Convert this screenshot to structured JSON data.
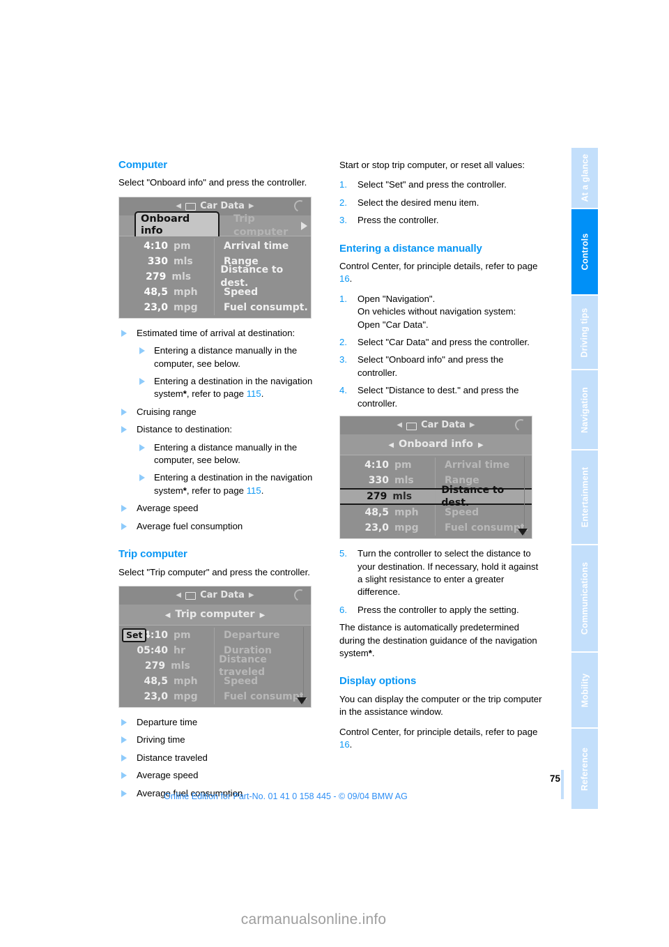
{
  "document": {
    "page_number": "75",
    "edition_line": "Online Edition for Part-No. 01 41 0 158 445 - © 09/04 BMW AG",
    "watermark": "carmanualsonline.info"
  },
  "colors": {
    "accent_blue": "#0a97f5",
    "tab_active": "#0090f7",
    "tab_inactive": "#c3dffb",
    "bullet_marker": "#8ecbfb"
  },
  "tabs": [
    {
      "label": "At a glance",
      "active": false
    },
    {
      "label": "Controls",
      "active": true
    },
    {
      "label": "Driving tips",
      "active": false
    },
    {
      "label": "Navigation",
      "active": false
    },
    {
      "label": "Entertainment",
      "active": false
    },
    {
      "label": "Communications",
      "active": false
    },
    {
      "label": "Mobility",
      "active": false
    },
    {
      "label": "Reference",
      "active": false
    }
  ],
  "left_column": {
    "computer": {
      "heading": "Computer",
      "intro": "Select \"Onboard info\" and press the controller.",
      "bullets": [
        {
          "text": "Estimated time of arrival at destination:",
          "sub": [
            {
              "text": "Entering a distance manually in the computer, see below."
            },
            {
              "text_pre": "Entering a destination in the navigation system",
              "star": "*",
              "text_mid": ", refer to page ",
              "page": "115",
              "text_post": "."
            }
          ]
        },
        {
          "text": "Cruising range",
          "sub": []
        },
        {
          "text": "Distance to destination:",
          "sub": [
            {
              "text": "Entering a distance manually in the computer, see below."
            },
            {
              "text_pre": "Entering a destination in the navigation system",
              "star": "*",
              "text_mid": ", refer to page ",
              "page": "115",
              "text_post": "."
            }
          ]
        },
        {
          "text": "Average speed",
          "sub": []
        },
        {
          "text": "Average fuel consumption",
          "sub": []
        }
      ]
    },
    "trip_computer": {
      "heading": "Trip computer",
      "intro": "Select \"Trip computer\" and press the controller.",
      "bullets": [
        "Departure time",
        "Driving time",
        "Distance traveled",
        "Average speed",
        "Average fuel consumption"
      ]
    }
  },
  "right_column": {
    "trip_actions": {
      "intro": "Start or stop trip computer, or reset all values:",
      "steps": [
        {
          "n": "1.",
          "text": "Select \"Set\" and press the controller."
        },
        {
          "n": "2.",
          "text": "Select the desired menu item."
        },
        {
          "n": "3.",
          "text": "Press the controller."
        }
      ]
    },
    "entering_distance": {
      "heading": "Entering a distance manually",
      "intro_pre": "Control Center, for principle details, refer to page ",
      "intro_page": "16",
      "intro_post": ".",
      "steps": [
        {
          "n": "1.",
          "text": "Open \"Navigation\".\nOn vehicles without navigation system:\nOpen \"Car Data\"."
        },
        {
          "n": "2.",
          "text": "Select \"Car Data\" and press the controller."
        },
        {
          "n": "3.",
          "text": "Select \"Onboard info\" and press the controller."
        },
        {
          "n": "4.",
          "text": "Select \"Distance to dest.\" and press the controller."
        },
        {
          "n": "5.",
          "text": "Turn the controller to select the distance to your destination. If necessary, hold it against a slight resistance to enter a greater difference."
        },
        {
          "n": "6.",
          "text": "Press the controller to apply the setting."
        }
      ],
      "note_pre": "The distance is automatically predetermined during the destination guidance of the navigation system",
      "note_star": "*",
      "note_post": "."
    },
    "display_options": {
      "heading": "Display options",
      "para1": "You can display the computer or the trip computer in the assistance window.",
      "para2_pre": "Control Center, for principle details, refer to page ",
      "para2_page": "16",
      "para2_post": "."
    }
  },
  "screens": {
    "onboard_info": {
      "title": "Car Data",
      "tab_selected": "Onboard info",
      "tab_other": "Trip computer",
      "rows": [
        {
          "value": "4:10",
          "unit": "pm",
          "label": "Arrival time",
          "selected": false
        },
        {
          "value": "330",
          "unit": "mls",
          "label": "Range",
          "selected": false
        },
        {
          "value": "279",
          "unit": "mls",
          "label": "Distance to dest.",
          "selected": false
        },
        {
          "value": "48,5",
          "unit": "mph",
          "label": "Speed",
          "selected": false
        },
        {
          "value": "23,0",
          "unit": "mpg",
          "label": "Fuel consumpt.",
          "selected": false
        }
      ]
    },
    "trip_computer": {
      "title": "Car Data",
      "submenu": "Trip computer",
      "set_button": "Set",
      "rows": [
        {
          "value": "4:10",
          "unit": "pm",
          "label": "Departure",
          "selected": false
        },
        {
          "value": "05:40",
          "unit": "hr",
          "label": "Duration",
          "selected": false
        },
        {
          "value": "279",
          "unit": "mls",
          "label": "Distance traveled",
          "selected": false
        },
        {
          "value": "48,5",
          "unit": "mph",
          "label": "Speed",
          "selected": false
        },
        {
          "value": "23,0",
          "unit": "mpg",
          "label": "Fuel consumpt.",
          "selected": false
        }
      ]
    },
    "onboard_info_selected": {
      "title": "Car Data",
      "submenu": "Onboard info",
      "rows": [
        {
          "value": "4:10",
          "unit": "pm",
          "label": "Arrival time",
          "selected": false
        },
        {
          "value": "330",
          "unit": "mls",
          "label": "Range",
          "selected": false
        },
        {
          "value": "279",
          "unit": "mls",
          "label": "Distance to dest.",
          "selected": true
        },
        {
          "value": "48,5",
          "unit": "mph",
          "label": "Speed",
          "selected": false
        },
        {
          "value": "23,0",
          "unit": "mpg",
          "label": "Fuel consumpt.",
          "selected": false
        }
      ]
    }
  }
}
